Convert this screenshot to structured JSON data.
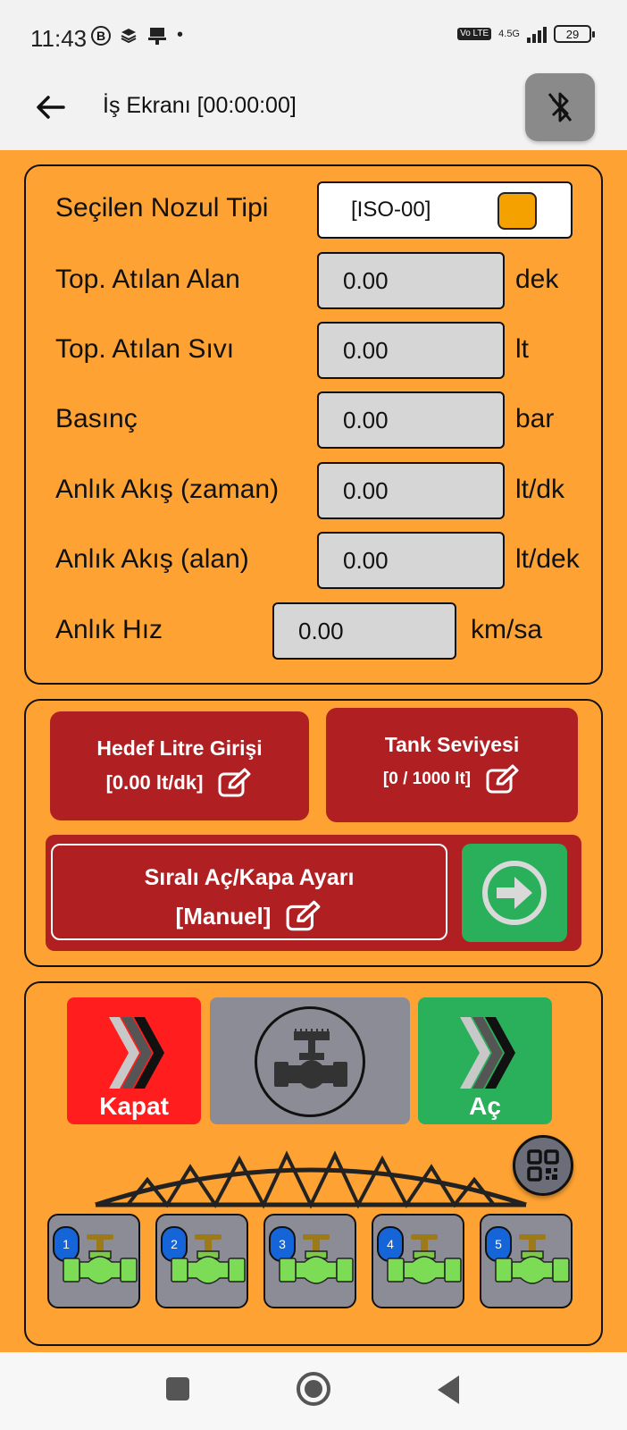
{
  "status_bar": {
    "time": "11:43",
    "b_icon": "B",
    "network": "4.5G",
    "volte": "Vo LTE",
    "battery": "29"
  },
  "app_bar": {
    "title": "İş Ekranı [00:00:00]",
    "back_icon": "arrow-left-icon",
    "bluetooth_icon": "bluetooth-disabled-icon"
  },
  "info_panel": {
    "nozzle_label": "Seçilen Nozul Tipi",
    "nozzle_value": "[ISO-00]",
    "nozzle_color": "#f5a100",
    "rows": [
      {
        "label": "Top. Atılan Alan",
        "value": "0.00",
        "unit": "dek"
      },
      {
        "label": "Top. Atılan Sıvı",
        "value": "0.00",
        "unit": "lt"
      },
      {
        "label": "Basınç",
        "value": "0.00",
        "unit": "bar"
      },
      {
        "label": "Anlık Akış (zaman)",
        "value": "0.00",
        "unit": "lt/dk"
      },
      {
        "label": "Anlık Akış (alan)",
        "value": "0.00",
        "unit": "lt/dek"
      },
      {
        "label": "Anlık Hız",
        "value": "0.00",
        "unit": "km/sa"
      }
    ]
  },
  "settings_panel": {
    "target_title": "Hedef Litre Girişi",
    "target_value": "[0.00 lt/dk]",
    "tank_title": "Tank Seviyesi",
    "tank_value": "[0 / 1000 lt]",
    "sequence_title": "Sıralı Aç/Kapa Ayarı",
    "sequence_value": "[Manuel]"
  },
  "control_panel": {
    "close_label": "Kapat",
    "open_label": "Aç",
    "sections": [
      "1",
      "2",
      "3",
      "4",
      "5"
    ]
  },
  "colors": {
    "background": "#fda233",
    "red_button": "#b01f22",
    "green_button": "#2ab05a",
    "close_red": "#ff1d1d",
    "grey_button": "#8c8c96",
    "section_badge": "#1565d8"
  }
}
